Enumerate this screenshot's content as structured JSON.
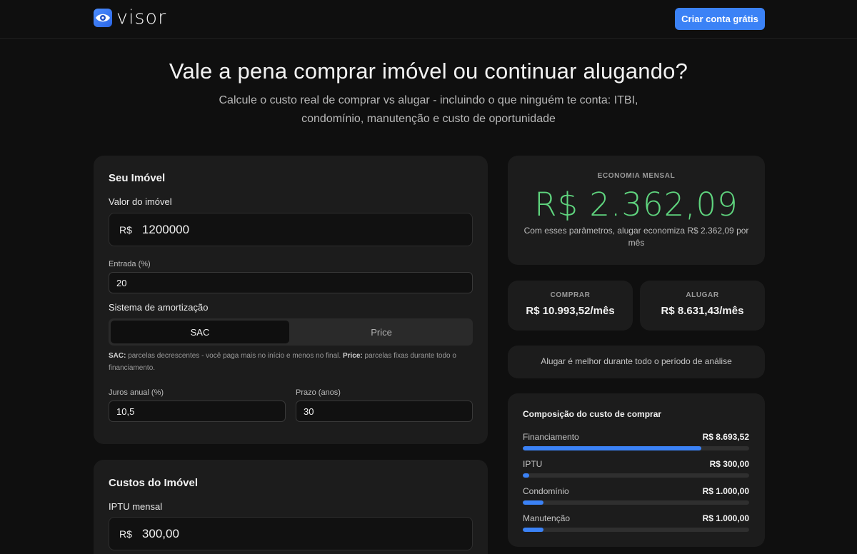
{
  "header": {
    "brand": "visor",
    "cta_label": "Criar conta grátis"
  },
  "hero": {
    "title": "Vale a pena comprar imóvel ou continuar alugando?",
    "subtitle": "Calcule o custo real de comprar vs alugar - incluindo o que ninguém te conta: ITBI, condomínio, manutenção e custo de oportunidade"
  },
  "property": {
    "title": "Seu Imóvel",
    "value_label": "Valor do imóvel",
    "currency_prefix": "R$",
    "value": "1200000",
    "down_payment_label": "Entrada (%)",
    "down_payment": "20",
    "amortization_label": "Sistema de amortização",
    "amortization_options": [
      "SAC",
      "Price"
    ],
    "amortization_selected": "SAC",
    "help": {
      "sac_term": "SAC:",
      "sac_text": " parcelas decrescentes - você paga mais no início e menos no final. ",
      "price_term": "Price:",
      "price_text": " parcelas fixas durante todo o financiamento."
    },
    "interest_label": "Juros anual (%)",
    "interest": "10,5",
    "term_label": "Prazo (anos)",
    "term": "30"
  },
  "costs": {
    "title": "Custos do Imóvel",
    "iptu_label": "IPTU mensal",
    "currency_prefix": "R$",
    "iptu": "300,00"
  },
  "summary": {
    "economy_label": "ECONOMIA MENSAL",
    "economy_value": "R$ 2.362,09",
    "economy_desc": "Com esses parâmetros, alugar economiza R$ 2.362,09 por mês",
    "economy_color": "#5fd47e",
    "buy_label": "COMPRAR",
    "buy_value": "R$ 10.993,52/mês",
    "rent_label": "ALUGAR",
    "rent_value": "R$ 8.631,43/mês",
    "verdict": "Alugar é melhor durante todo o período de análise"
  },
  "composition": {
    "title": "Composição do custo de comprar",
    "bar_color": "#3b82f6",
    "items": [
      {
        "name": "Financiamento",
        "amount": "R$ 8.693,52",
        "share": 0.79
      },
      {
        "name": "IPTU",
        "amount": "R$ 300,00",
        "share": 0.027
      },
      {
        "name": "Condomínio",
        "amount": "R$ 1.000,00",
        "share": 0.091
      },
      {
        "name": "Manutenção",
        "amount": "R$ 1.000,00",
        "share": 0.091
      }
    ]
  }
}
